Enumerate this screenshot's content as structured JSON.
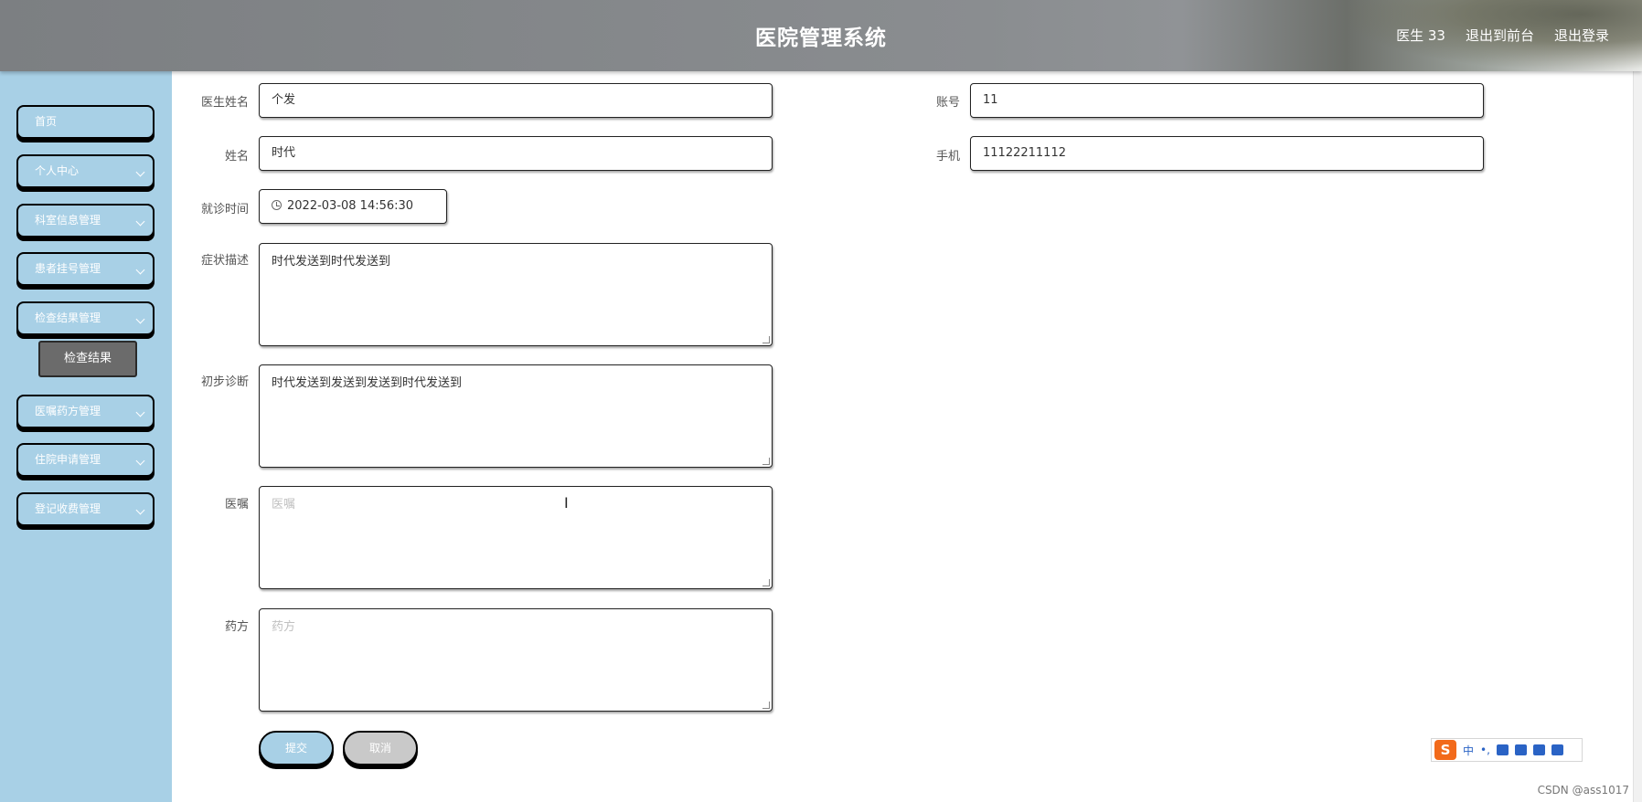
{
  "header": {
    "title": "医院管理系统",
    "user_label": "医生 33",
    "exit_front_label": "退出到前台",
    "logout_label": "退出登录"
  },
  "sidebar": {
    "items": [
      {
        "label": "首页",
        "has_submenu": false
      },
      {
        "label": "个人中心",
        "has_submenu": true
      },
      {
        "label": "科室信息管理",
        "has_submenu": true
      },
      {
        "label": "患者挂号管理",
        "has_submenu": true
      },
      {
        "label": "检查结果管理",
        "has_submenu": true
      },
      {
        "label": "医嘱药方管理",
        "has_submenu": true
      },
      {
        "label": "住院申请管理",
        "has_submenu": true
      },
      {
        "label": "登记收费管理",
        "has_submenu": true
      }
    ],
    "active_subitem": "检查结果"
  },
  "form": {
    "doctor_name": {
      "label": "医生姓名",
      "value": "个发"
    },
    "account": {
      "label": "账号",
      "value": "11"
    },
    "name": {
      "label": "姓名",
      "value": "时代"
    },
    "phone": {
      "label": "手机",
      "value": "11122211112"
    },
    "visit_time": {
      "label": "就诊时间",
      "value": "2022-03-08 14:56:30"
    },
    "symptoms": {
      "label": "症状描述",
      "value": "时代发送到时代发送到"
    },
    "diagnosis": {
      "label": "初步诊断",
      "value": "时代发送到发送到发送到时代发送到"
    },
    "advice": {
      "label": "医嘱",
      "value": "",
      "placeholder": "医嘱"
    },
    "prescription": {
      "label": "药方",
      "value": "",
      "placeholder": "药方"
    },
    "submit_label": "提交",
    "cancel_label": "取消"
  },
  "ime": {
    "logo": "S",
    "mode": "中",
    "punct": "•,"
  },
  "watermark": "CSDN @ass1017",
  "colors": {
    "sidebar_bg": "#a8d0e6",
    "header_bg": "#8a8d90",
    "submenu_active": "#6b6b6b"
  }
}
